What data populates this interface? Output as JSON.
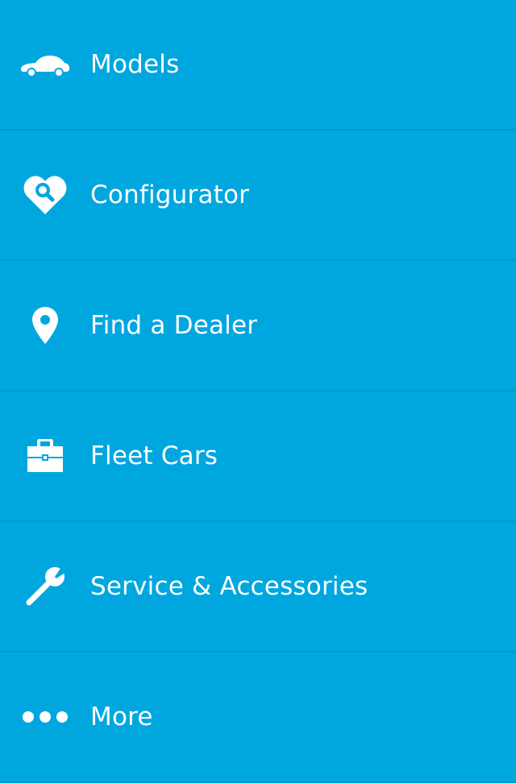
{
  "menu": {
    "items": [
      {
        "label": "Models",
        "icon": "car-icon"
      },
      {
        "label": "Configurator",
        "icon": "heart-search-icon"
      },
      {
        "label": "Find a Dealer",
        "icon": "map-pin-icon"
      },
      {
        "label": "Fleet Cars",
        "icon": "briefcase-icon"
      },
      {
        "label": "Service & Accessories",
        "icon": "wrench-icon"
      },
      {
        "label": "More",
        "icon": "more-dots-icon"
      }
    ]
  },
  "colors": {
    "background": "#00A7DF",
    "divider": "#0098CC",
    "text": "#FFFFFF"
  }
}
